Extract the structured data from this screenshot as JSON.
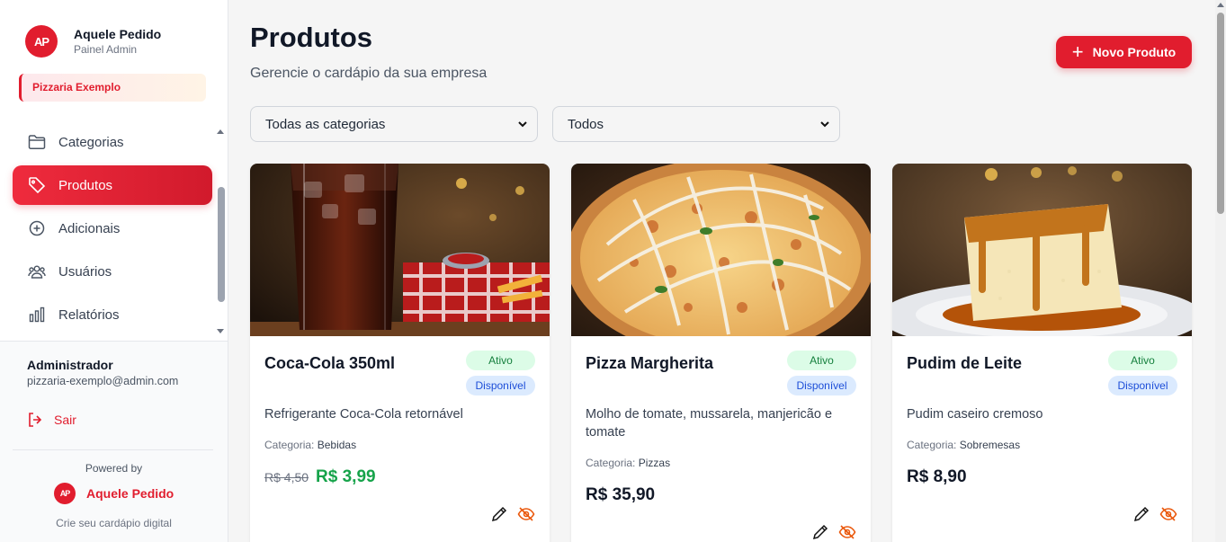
{
  "brand": {
    "name": "Aquele Pedido",
    "subtitle": "Painel Admin",
    "logo_text": "AP"
  },
  "company": "Pizzaria Exemplo",
  "nav": [
    {
      "label": "Categorias",
      "icon": "folder-icon",
      "active": false
    },
    {
      "label": "Produtos",
      "icon": "tag-icon",
      "active": true
    },
    {
      "label": "Adicionais",
      "icon": "plus-circle-icon",
      "active": false
    },
    {
      "label": "Usuários",
      "icon": "users-icon",
      "active": false
    },
    {
      "label": "Relatórios",
      "icon": "bar-chart-icon",
      "active": false
    }
  ],
  "user": {
    "name": "Administrador",
    "email": "pizzaria-exemplo@admin.com",
    "logout": "Sair"
  },
  "footer": {
    "powered_by": "Powered by",
    "brand": "Aquele Pedido",
    "tagline": "Crie seu cardápio digital"
  },
  "header": {
    "title": "Produtos",
    "subtitle": "Gerencie o cardápio da sua empresa",
    "new_button": "Novo Produto"
  },
  "filters": {
    "category": "Todas as categorias",
    "status": "Todos"
  },
  "products": [
    {
      "name": "Coca-Cola 350ml",
      "status": "Ativo",
      "availability": "Disponível",
      "description": "Refrigerante Coca-Cola retornável",
      "category_label": "Categoria:",
      "category": "Bebidas",
      "old_price": "R$ 4,50",
      "price": "R$ 3,99"
    },
    {
      "name": "Pizza Margherita",
      "status": "Ativo",
      "availability": "Disponível",
      "description": "Molho de tomate, mussarela, manjericão e tomate",
      "category_label": "Categoria:",
      "category": "Pizzas",
      "old_price": "",
      "price": "R$ 35,90"
    },
    {
      "name": "Pudim de Leite",
      "status": "Ativo",
      "availability": "Disponível",
      "description": "Pudim caseiro cremoso",
      "category_label": "Categoria:",
      "category": "Sobremesas",
      "old_price": "",
      "price": "R$ 8,90"
    }
  ],
  "colors": {
    "primary": "#e11d2e",
    "success": "#16a34a"
  }
}
